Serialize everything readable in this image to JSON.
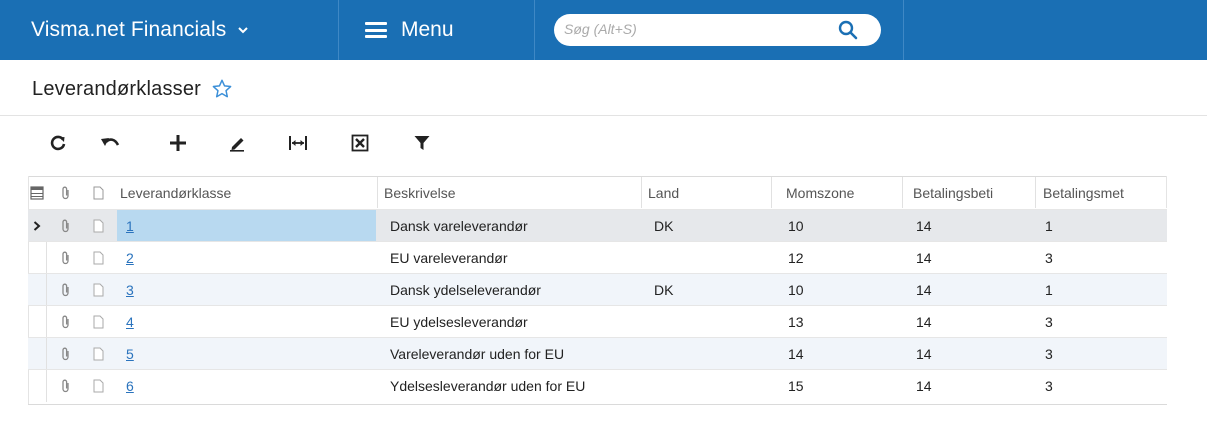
{
  "app": {
    "title": "Visma.net Financials",
    "menu_label": "Menu",
    "search_placeholder": "Søg (Alt+S)",
    "brand_color": "#1a6fb4"
  },
  "page": {
    "title": "Leverandørklasser",
    "favorite_icon": "star-outline-icon"
  },
  "toolbar": {
    "buttons": [
      {
        "name": "refresh",
        "icon": "refresh-icon"
      },
      {
        "name": "undo",
        "icon": "undo-icon"
      },
      {
        "name": "add",
        "icon": "plus-icon"
      },
      {
        "name": "edit",
        "icon": "pencil-icon"
      },
      {
        "name": "fit-columns",
        "icon": "fit-width-icon"
      },
      {
        "name": "export-excel",
        "icon": "excel-export-icon"
      },
      {
        "name": "filter",
        "icon": "filter-icon"
      }
    ]
  },
  "grid": {
    "columns": [
      "Leverandørklasse",
      "Beskrivelse",
      "Land",
      "Momszone",
      "Betalingsbeti",
      "Betalingsmet"
    ],
    "rows": [
      {
        "class": "1",
        "description": "Dansk vareleverandør",
        "land": "DK",
        "moms": "10",
        "betbet": "14",
        "betmet": "1",
        "selected": true
      },
      {
        "class": "2",
        "description": "EU vareleverandør",
        "land": "",
        "moms": "12",
        "betbet": "14",
        "betmet": "3"
      },
      {
        "class": "3",
        "description": "Dansk ydelseleverandør",
        "land": "DK",
        "moms": "10",
        "betbet": "14",
        "betmet": "1"
      },
      {
        "class": "4",
        "description": "EU ydelsesleverandør",
        "land": "",
        "moms": "13",
        "betbet": "14",
        "betmet": "3"
      },
      {
        "class": "5",
        "description": "Vareleverandør uden for EU",
        "land": "",
        "moms": "14",
        "betbet": "14",
        "betmet": "3"
      },
      {
        "class": "6",
        "description": "Ydelsesleverandør uden for EU",
        "land": "",
        "moms": "15",
        "betbet": "14",
        "betmet": "3"
      }
    ]
  }
}
